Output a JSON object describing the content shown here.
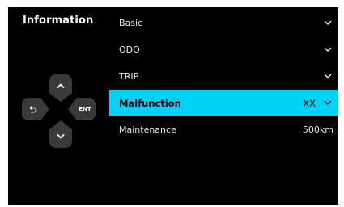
{
  "header": {
    "title": "Information"
  },
  "dpad": {
    "up_icon": "chevron-up-icon",
    "down_icon": "chevron-down-icon",
    "back_icon": "back-arrow-icon",
    "enter_label": "ENT"
  },
  "menu": {
    "items": [
      {
        "label": "Basic",
        "value": "",
        "expandable": true,
        "selected": false
      },
      {
        "label": "ODO",
        "value": "",
        "expandable": true,
        "selected": false
      },
      {
        "label": "TRIP",
        "value": "",
        "expandable": true,
        "selected": false
      },
      {
        "label": "Malfunction",
        "value": "XX",
        "expandable": true,
        "selected": true
      },
      {
        "label": "Maintenance",
        "value": "500km",
        "expandable": false,
        "selected": false
      }
    ]
  },
  "colors": {
    "screen_bg": "#000000",
    "highlight": "#00d2f5",
    "key_bg": "#3a3a3a",
    "text": "#ffffff"
  }
}
